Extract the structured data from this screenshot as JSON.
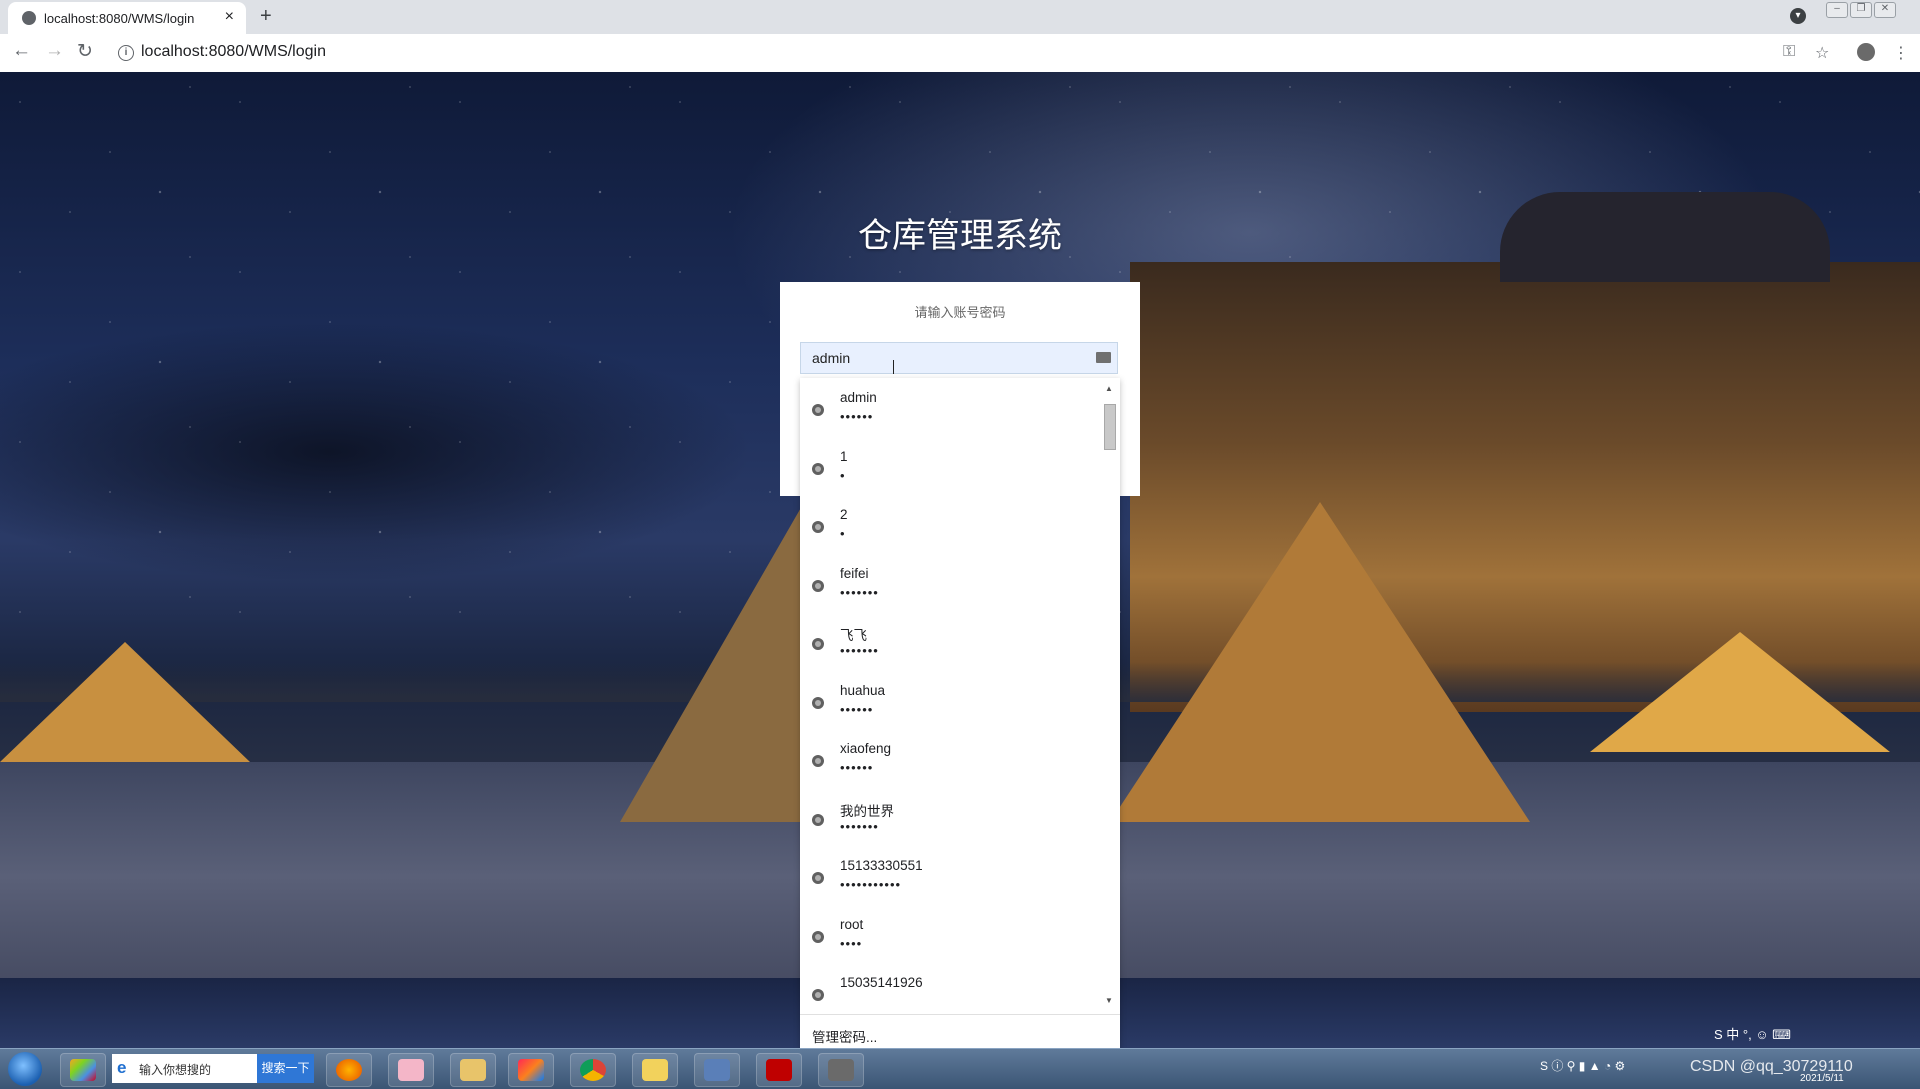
{
  "browser": {
    "tab_title": "localhost:8080/WMS/login",
    "tab_close": "×",
    "new_tab": "+",
    "url": "localhost:8080/WMS/login",
    "back": "←",
    "forward": "→",
    "reload": "↻",
    "key_icon": "⚿",
    "star_icon": "☆",
    "menu_icon": "⋮",
    "window_buttons": [
      "–",
      "❐",
      "✕"
    ]
  },
  "login": {
    "system_title": "仓库管理系统",
    "prompt": "请输入账号密码",
    "username_value": "admin"
  },
  "autofill": {
    "items": [
      {
        "user": "admin",
        "pass": "••••••"
      },
      {
        "user": "1",
        "pass": "•"
      },
      {
        "user": "2",
        "pass": "•"
      },
      {
        "user": "feifei",
        "pass": "•••••••"
      },
      {
        "user": "飞飞",
        "pass": "•••••••"
      },
      {
        "user": "huahua",
        "pass": "••••••"
      },
      {
        "user": "xiaofeng",
        "pass": "••••••"
      },
      {
        "user": "我的世界",
        "pass": "•••••••"
      },
      {
        "user": "15133330551",
        "pass": "•••••••••••"
      },
      {
        "user": "root",
        "pass": "••••"
      },
      {
        "user": "15035141926",
        "pass": ""
      }
    ],
    "manage_label": "管理密码...",
    "scroll_up": "▲",
    "scroll_down": "▼"
  },
  "taskbar": {
    "search_placeholder": "输入你想搜的",
    "search_button": "搜索一下",
    "ime": "S 中 °, ☺ ⌨",
    "watermark": "CSDN @qq_30729110",
    "date": "2021/5/11"
  },
  "colors": {
    "accent_blue": "#2f77d6",
    "autofill_bg": "#e8f0fe"
  }
}
